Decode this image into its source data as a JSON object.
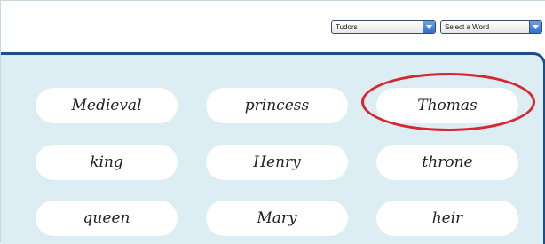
{
  "toolbar": {
    "topic_select": {
      "value": "Tudors"
    },
    "word_select": {
      "value": "Select a Word"
    }
  },
  "words": {
    "row1": [
      "Medieval",
      "princess",
      "Thomas"
    ],
    "row2": [
      "king",
      "Henry",
      "throne"
    ],
    "row3": [
      "queen",
      "Mary",
      "heir"
    ]
  },
  "highlight": {
    "word": "Thomas",
    "color": "#d8252f"
  },
  "colors": {
    "panel_background": "#dcedf3",
    "panel_border": "#1d4f8c",
    "dropdown_accent": "#2f6fd2"
  },
  "icons": {
    "dropdown_arrow": "chevron-down-icon"
  }
}
